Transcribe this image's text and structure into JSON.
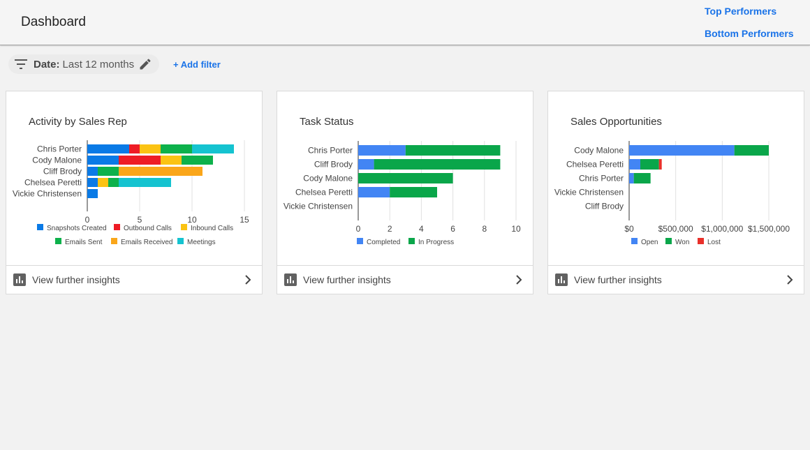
{
  "header": {
    "title": "Dashboard",
    "top_performers": "Top Performers",
    "bottom_performers": "Bottom Performers"
  },
  "filter": {
    "label": "Date:",
    "value": "Last 12 months",
    "add_filter": "+ Add filter"
  },
  "cards": [
    {
      "title": "Activity by Sales Rep",
      "footer": "View further insights"
    },
    {
      "title": "Task Status",
      "footer": "View further insights"
    },
    {
      "title": "Sales Opportunities",
      "footer": "View further insights"
    }
  ],
  "colors": {
    "blue": "#0a7ae6",
    "red": "#ee1c25",
    "yellow": "#fbc313",
    "green": "#0db14b",
    "orange": "#faa61a",
    "teal": "#15c3d0",
    "blue2": "#4285f4",
    "green2": "#0aa64a",
    "red2": "#e9302a",
    "link": "#1a73e8"
  },
  "chart_data": [
    {
      "type": "bar",
      "orientation": "horizontal",
      "stacked": true,
      "title": "Activity by Sales Rep",
      "categories": [
        "Chris Porter",
        "Cody Malone",
        "Cliff Brody",
        "Chelsea Peretti",
        "Vickie Christensen"
      ],
      "series": [
        {
          "name": "Snapshots Created",
          "color": "#0a7ae6",
          "values": [
            4,
            3,
            1,
            1,
            1
          ]
        },
        {
          "name": "Outbound Calls",
          "color": "#ee1c25",
          "values": [
            1,
            4,
            0,
            0,
            0
          ]
        },
        {
          "name": "Inbound Calls",
          "color": "#fbc313",
          "values": [
            2,
            2,
            0,
            1,
            0
          ]
        },
        {
          "name": "Emails Sent",
          "color": "#0db14b",
          "values": [
            3,
            3,
            2,
            1,
            0
          ]
        },
        {
          "name": "Emails Received",
          "color": "#faa61a",
          "values": [
            0,
            0,
            8,
            0,
            0
          ]
        },
        {
          "name": "Meetings",
          "color": "#15c3d0",
          "values": [
            4,
            0,
            0,
            5,
            0
          ]
        }
      ],
      "xlim": [
        0,
        15
      ],
      "xticks": [
        "0",
        "5",
        "10",
        "15"
      ],
      "legend_position": "bottom"
    },
    {
      "type": "bar",
      "orientation": "horizontal",
      "stacked": true,
      "title": "Task Status",
      "categories": [
        "Chris Porter",
        "Cliff Brody",
        "Cody Malone",
        "Chelsea Peretti",
        "Vickie Christensen"
      ],
      "series": [
        {
          "name": "Completed",
          "color": "#4285f4",
          "values": [
            3,
            1,
            0,
            2,
            0
          ]
        },
        {
          "name": "In Progress",
          "color": "#0aa64a",
          "values": [
            6,
            8,
            6,
            3,
            0
          ]
        }
      ],
      "xlim": [
        0,
        10
      ],
      "xticks": [
        "0",
        "2",
        "4",
        "6",
        "8",
        "10"
      ],
      "legend_position": "bottom"
    },
    {
      "type": "bar",
      "orientation": "horizontal",
      "stacked": true,
      "title": "Sales Opportunities",
      "categories": [
        "Cody Malone",
        "Chelsea Peretti",
        "Chris Porter",
        "Vickie Christensen",
        "Cliff Brody"
      ],
      "series": [
        {
          "name": "Open",
          "color": "#4285f4",
          "values": [
            1130000,
            120000,
            50000,
            0,
            0
          ]
        },
        {
          "name": "Won",
          "color": "#0aa64a",
          "values": [
            370000,
            200000,
            180000,
            0,
            0
          ]
        },
        {
          "name": "Lost",
          "color": "#e9302a",
          "values": [
            0,
            30000,
            0,
            0,
            0
          ]
        }
      ],
      "xlim": [
        0,
        1500000
      ],
      "xticks": [
        "$0",
        "$500,000",
        "$1,000,000",
        "$1,500,000"
      ],
      "legend_position": "bottom"
    }
  ]
}
